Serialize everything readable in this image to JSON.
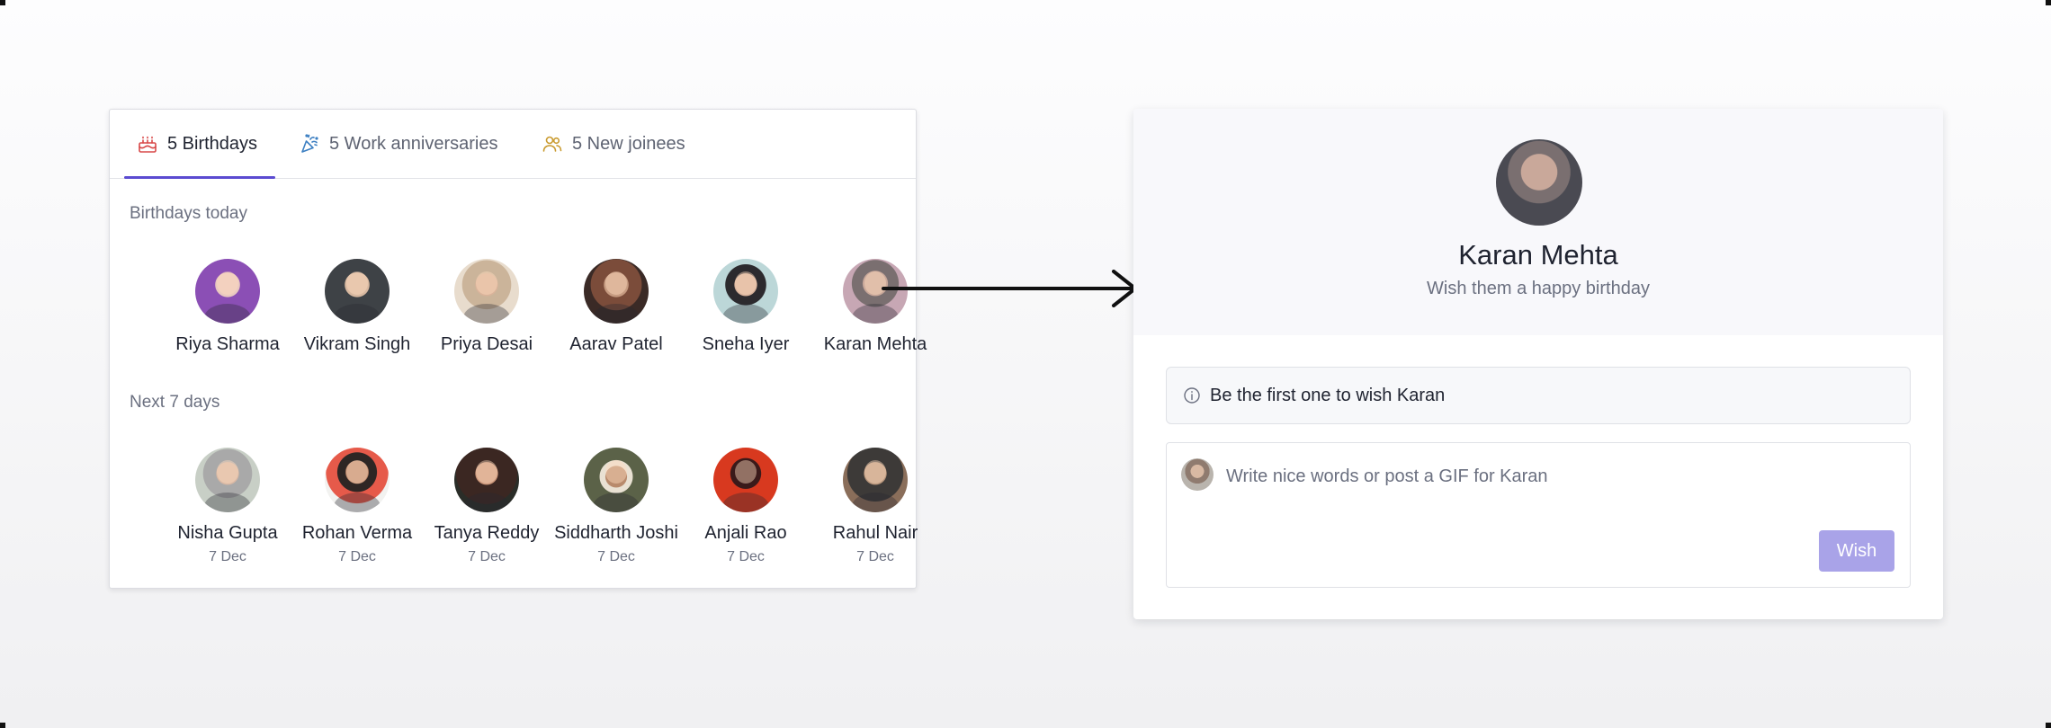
{
  "tabs": [
    {
      "label": "5 Birthdays",
      "icon": "cake-icon",
      "color": "#d84848",
      "active": true
    },
    {
      "label": "5 Work anniversaries",
      "icon": "party-popper-icon",
      "color": "#3c7fc2",
      "active": false
    },
    {
      "label": "5 New joinees",
      "icon": "users-icon",
      "color": "#c99a2e",
      "active": false
    }
  ],
  "sections": {
    "today_title": "Birthdays today",
    "next_title": "Next 7 days"
  },
  "birthdays_today": [
    {
      "name": "Riya Sharma"
    },
    {
      "name": "Vikram Singh"
    },
    {
      "name": "Priya Desai"
    },
    {
      "name": "Aarav Patel"
    },
    {
      "name": "Sneha Iyer"
    },
    {
      "name": "Karan Mehta"
    }
  ],
  "next_7_days": [
    {
      "name": "Nisha Gupta",
      "date": "7 Dec"
    },
    {
      "name": "Rohan Verma",
      "date": "7 Dec"
    },
    {
      "name": "Tanya Reddy",
      "date": "7 Dec"
    },
    {
      "name": "Siddharth Joshi",
      "date": "7 Dec"
    },
    {
      "name": "Anjali Rao",
      "date": "7 Dec"
    },
    {
      "name": "Rahul Nair",
      "date": "7 Dec"
    }
  ],
  "detail": {
    "name": "Karan Mehta",
    "subtitle": "Wish them a happy birthday",
    "notice": "Be the first one to wish Karan",
    "composer_placeholder": "Write nice words or post a GIF for Karan",
    "wish_label": "Wish"
  },
  "colors": {
    "accent": "#5b4bd1",
    "wish_button": "#a9a3e8"
  }
}
